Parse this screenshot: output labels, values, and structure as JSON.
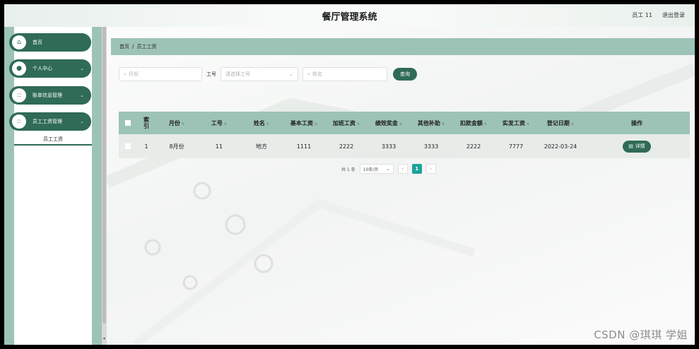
{
  "header": {
    "title": "餐厅管理系统",
    "user": "员工 11",
    "logout": "退出登录"
  },
  "sidebar": {
    "items": [
      {
        "label": "首页",
        "icon": "home-icon",
        "glyph": "⌂",
        "chevron": ""
      },
      {
        "label": "个人中心",
        "icon": "user-icon",
        "glyph": "●",
        "chevron": "⌄"
      },
      {
        "label": "账单信息管理",
        "icon": "grid-icon",
        "glyph": "::",
        "chevron": "⌄"
      },
      {
        "label": "员工工资管理",
        "icon": "grid-icon",
        "glyph": "::",
        "chevron": "⌄"
      }
    ],
    "submenu": {
      "label": "员工工资"
    }
  },
  "breadcrumb": {
    "home": "首页",
    "sep": "/",
    "current": "员工工资"
  },
  "search": {
    "month_placeholder": "月份",
    "id_label": "工号",
    "id_placeholder": "请选择工号",
    "name_placeholder": "姓名",
    "button": "查询"
  },
  "table": {
    "headers": [
      "索引",
      "月份",
      "工号",
      "姓名",
      "基本工资",
      "加班工资",
      "绩效奖金",
      "其他补助",
      "扣款金额",
      "实发工资",
      "登记日期",
      "操作"
    ],
    "rows": [
      {
        "index": "1",
        "month": "8月份",
        "id": "11",
        "name": "地方",
        "base": "1111",
        "overtime": "2222",
        "bonus": "3333",
        "subsidy": "3333",
        "deduction": "2222",
        "net": "7777",
        "date": "2022-03-24",
        "action": "详情"
      }
    ]
  },
  "pagination": {
    "total": "共 1 条",
    "page_size": "10条/页",
    "prev": "‹",
    "current": "1",
    "next": "›"
  },
  "watermark": "CSDN @琪琪 学姐",
  "colors": {
    "primary": "#2f6b56",
    "accent": "#9dc3b7",
    "pager_active": "#1aa39a"
  }
}
